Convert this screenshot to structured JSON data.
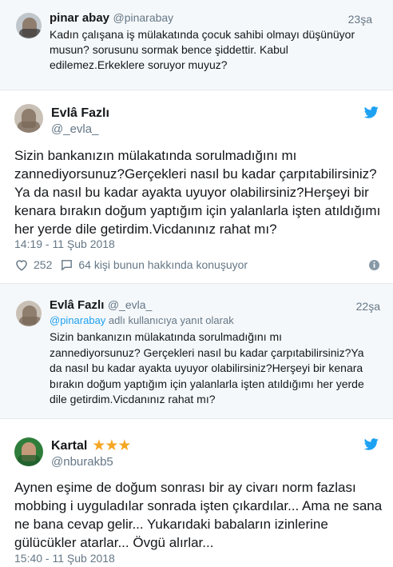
{
  "tweet1": {
    "name": "pinar abay",
    "handle": "@pinarabay",
    "time": "23şa",
    "text": "Kadın çalışana iş mülakatında çocuk sahibi olmayı düşünüyor musun? sorusunu sormak bence şiddettir. Kabul edilemez.Erkeklere soruyor muyuz?"
  },
  "tweet2": {
    "name": "Evlâ Fazlı",
    "handle": "@_evla_",
    "text": "Sizin bankanızın mülakatında sorulmadığını mı zannediyorsunuz?Gerçekleri nasıl bu kadar çarpıtabilirsiniz?Ya da nasıl bu kadar ayakta uyuyor olabilirsiniz?Herşeyi bir kenara bırakın doğum yaptığım için yalanlarla işten atıldığımı her yerde dile getirdim.Vicdanınız rahat mı?",
    "timestamp": "14:19 - 11 Şub 2018",
    "likes": "252",
    "replies_text": "64 kişi bunun hakkında konuşuyor"
  },
  "tweet3": {
    "name": "Evlâ Fazlı",
    "handle": "@_evla_",
    "time": "22şa",
    "reply_to_handle": "@pinarabay",
    "reply_to_suffix": " adlı kullanıcıya yanıt olarak",
    "text": "Sizin bankanızın mülakatında sorulmadığını mı zannediyorsunuz? Gerçekleri nasıl bu kadar çarpıtabilirsiniz?Ya da nasıl bu kadar ayakta uyuyor olabilirsiniz?Herşeyi bir kenara bırakın doğum yaptığım için yalanlarla işten atıldığımı her yerde dile getirdim.Vicdanınız rahat mı?"
  },
  "tweet4": {
    "name": "Kartal",
    "stars": "★★★",
    "handle": "@nburakb5",
    "text": "Aynen eşime de doğum sonrası bir ay civarı norm fazlası mobbing i uyguladılar sonrada işten çıkardılar... Ama ne sana ne bana cevap gelir... Yukarıdaki babaların izinlerine gülücükler atarlar... Övgü alırlar...",
    "timestamp": "15:40 - 11 Şub 2018"
  },
  "colors": {
    "twitter_blue": "#1da1f2",
    "muted": "#657786",
    "star": "#f5a623"
  },
  "icons": {
    "bird": "twitter-bird-icon",
    "heart": "heart-icon",
    "speech": "speech-bubble-icon",
    "info": "info-icon"
  }
}
